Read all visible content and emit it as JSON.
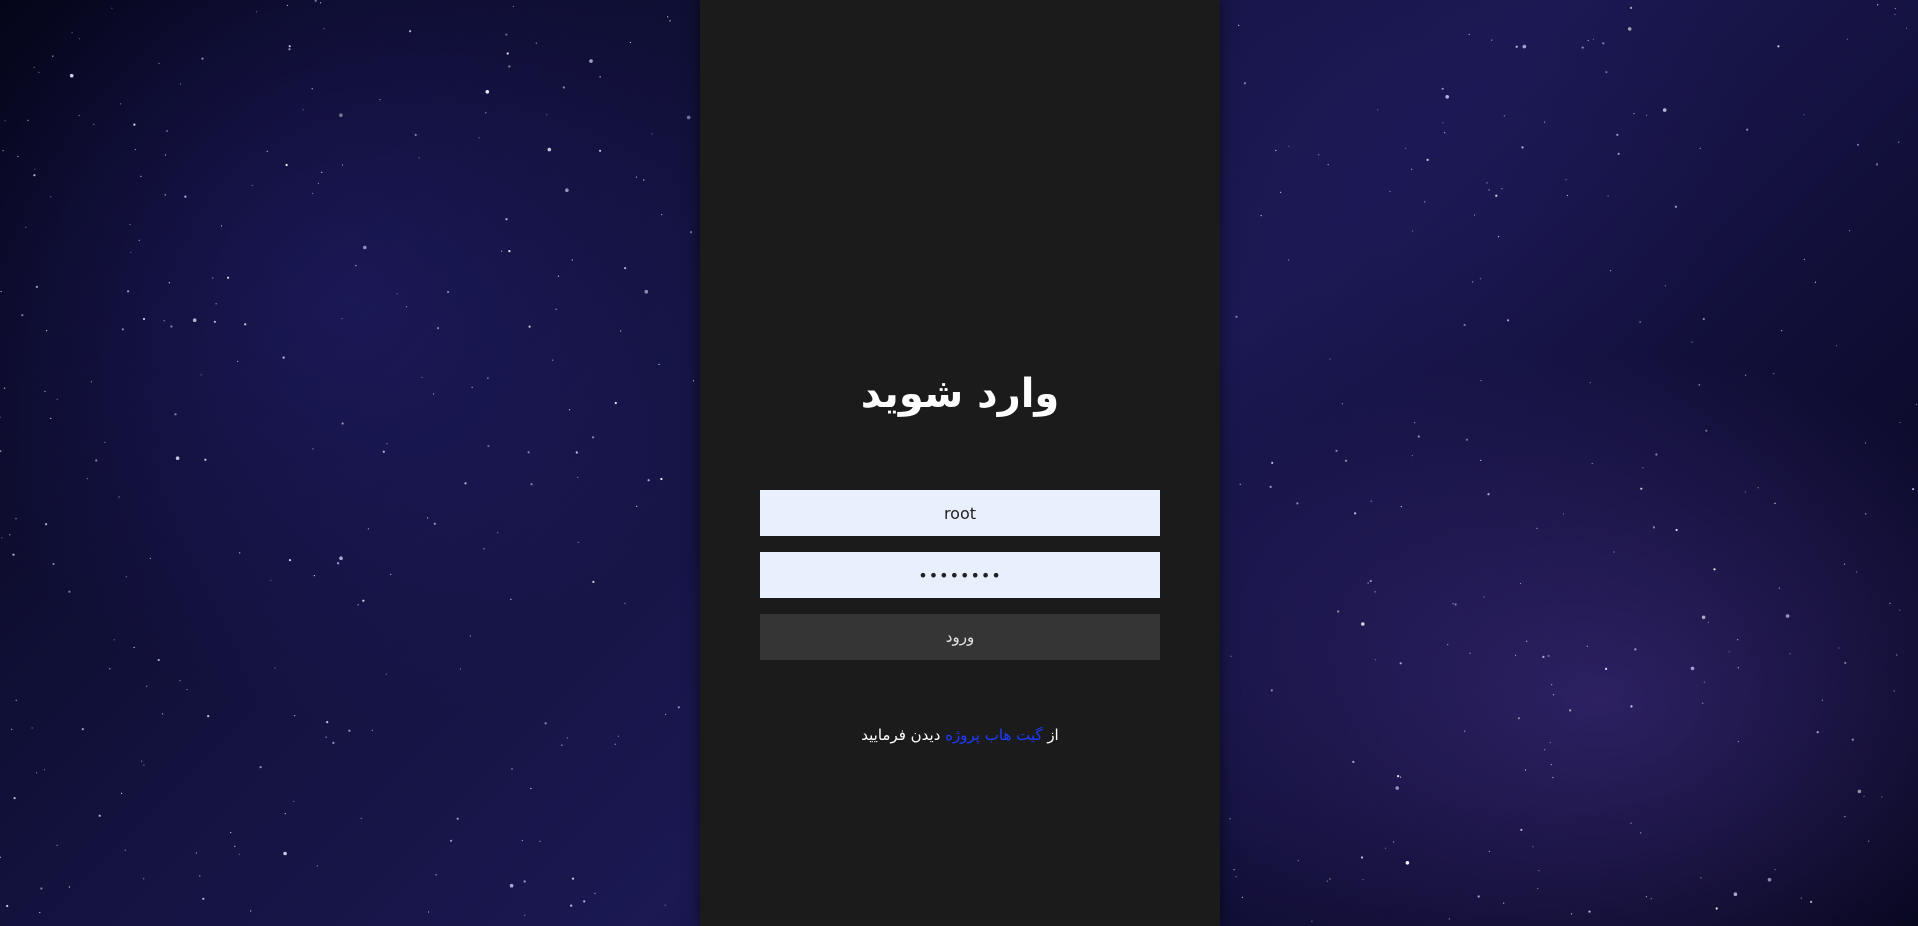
{
  "login": {
    "title": "وارد شوید",
    "username_value": "root",
    "password_value": "password",
    "submit_label": "ورود"
  },
  "footer": {
    "prefix": "از",
    "link_text": "گیت هاب پروژه",
    "suffix": "دیدن فرمایید"
  },
  "colors": {
    "panel": "#1b1b1b",
    "input_bg": "#e8f0fe",
    "button_bg": "#353535",
    "link": "#1f3cff"
  }
}
